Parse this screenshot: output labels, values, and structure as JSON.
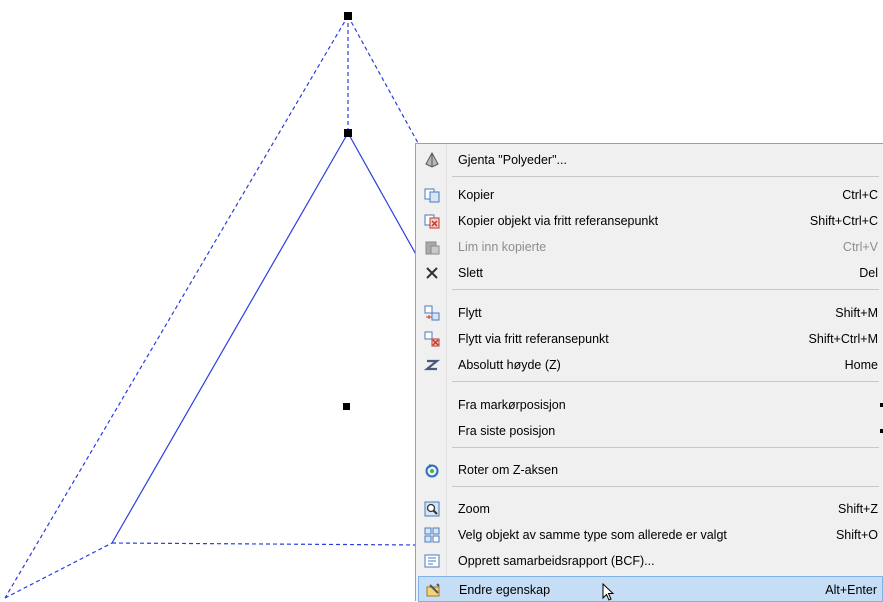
{
  "menu": {
    "items": [
      {
        "label": "Gjenta \"Polyeder\"...",
        "shortcut": "",
        "icon": "polyhedron-icon"
      },
      {
        "label": "Kopier",
        "shortcut": "Ctrl+C",
        "icon": "copy-icon"
      },
      {
        "label": "Kopier objekt via fritt referansepunkt",
        "shortcut": "Shift+Ctrl+C",
        "icon": "copy-reference-icon"
      },
      {
        "label": "Lim inn kopierte",
        "shortcut": "Ctrl+V",
        "icon": "paste-icon",
        "disabled": true
      },
      {
        "label": "Slett",
        "shortcut": "Del",
        "icon": "delete-icon"
      },
      {
        "label": "Flytt",
        "shortcut": "Shift+M",
        "icon": "move-icon"
      },
      {
        "label": "Flytt via fritt referansepunkt",
        "shortcut": "Shift+Ctrl+M",
        "icon": "move-reference-icon"
      },
      {
        "label": "Absolutt høyde (Z)",
        "shortcut": "Home",
        "icon": "z-height-icon"
      },
      {
        "label": "Fra markørposisjon",
        "shortcut": "",
        "icon": "",
        "submenu": true
      },
      {
        "label": "Fra siste posisjon",
        "shortcut": "",
        "icon": "",
        "submenu": true
      },
      {
        "label": "Roter om Z-aksen",
        "shortcut": "",
        "icon": "rotate-z-icon"
      },
      {
        "label": "Zoom",
        "shortcut": "Shift+Z",
        "icon": "zoom-icon"
      },
      {
        "label": "Velg objekt av samme type som allerede er valgt",
        "shortcut": "Shift+O",
        "icon": "select-same-type-icon"
      },
      {
        "label": "Opprett samarbeidsrapport (BCF)...",
        "shortcut": "",
        "icon": "bcf-report-icon"
      },
      {
        "label": "Endre egenskap",
        "shortcut": "Alt+Enter",
        "icon": "properties-icon",
        "highlighted": true
      }
    ]
  },
  "colors": {
    "line": "#2a3de0",
    "menu_bg": "#f0f0f0",
    "highlight": "#c6ddf6"
  }
}
